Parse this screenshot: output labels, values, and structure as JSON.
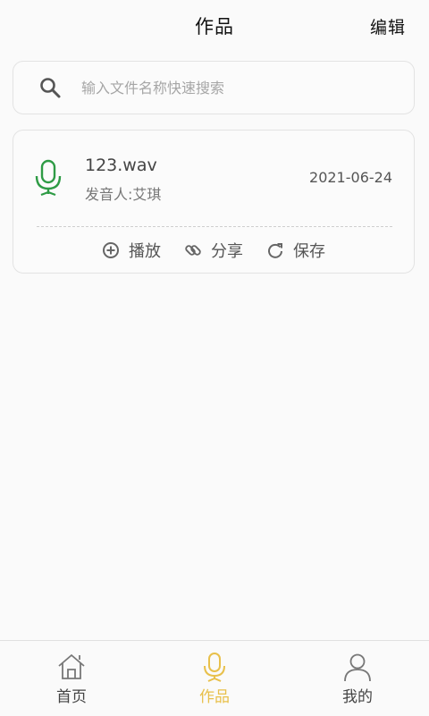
{
  "header": {
    "title": "作品",
    "edit_label": "编辑"
  },
  "search": {
    "placeholder": "输入文件名称快速搜索",
    "icon": "search-icon"
  },
  "works": [
    {
      "filename": "123.wav",
      "speaker": "发音人:艾琪",
      "date": "2021-06-24",
      "icon": "microphone-icon",
      "icon_color": "#2e9b45",
      "actions": [
        {
          "label": "播放",
          "icon": "plus-circle-icon"
        },
        {
          "label": "分享",
          "icon": "link-icon"
        },
        {
          "label": "保存",
          "icon": "refresh-icon"
        }
      ]
    }
  ],
  "tabbar": {
    "active_color": "#e8c04b",
    "items": [
      {
        "label": "首页",
        "icon": "home-icon"
      },
      {
        "label": "作品",
        "icon": "microphone-icon",
        "active": true
      },
      {
        "label": "我的",
        "icon": "user-icon"
      }
    ]
  }
}
